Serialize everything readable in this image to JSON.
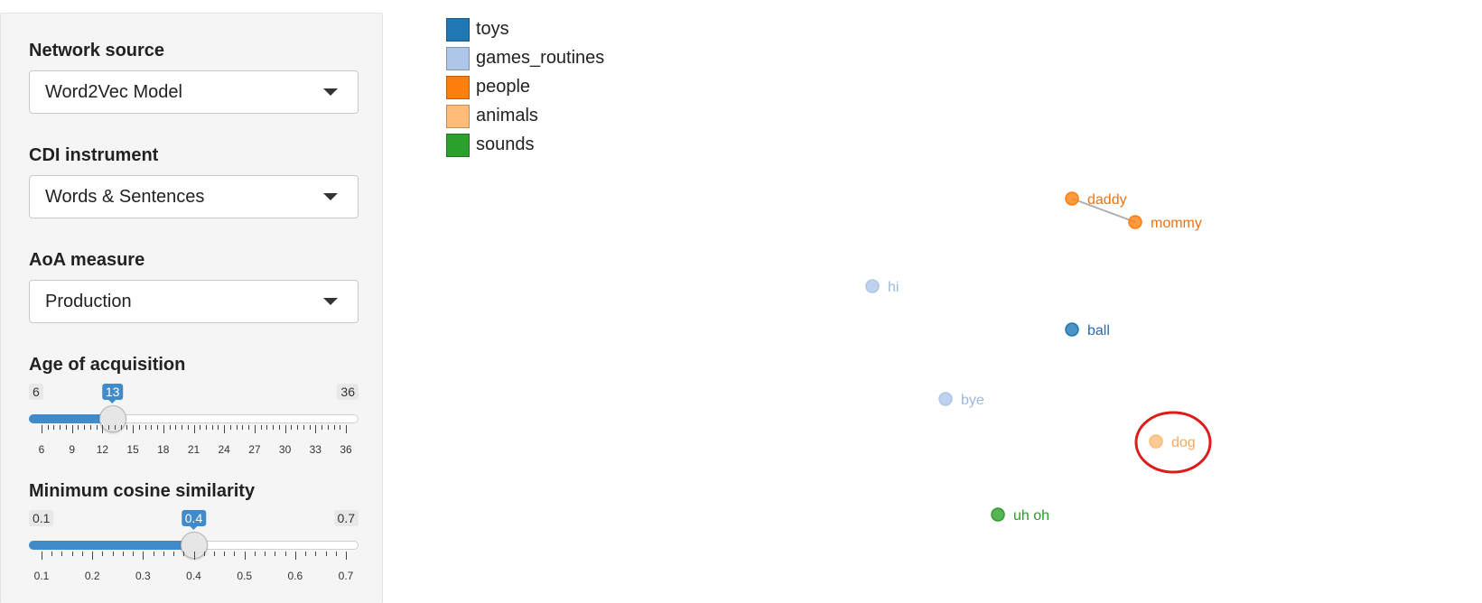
{
  "sidebar": {
    "network_source": {
      "label": "Network source",
      "value": "Word2Vec Model"
    },
    "cdi_instrument": {
      "label": "CDI instrument",
      "value": "Words & Sentences"
    },
    "aoa_measure": {
      "label": "AoA measure",
      "value": "Production"
    },
    "age_of_acquisition": {
      "label": "Age of acquisition",
      "min": 6,
      "max": 36,
      "value": 13,
      "min_label": "6",
      "max_label": "36",
      "value_label": "13",
      "tick_labels": [
        "6",
        "9",
        "12",
        "15",
        "18",
        "21",
        "24",
        "27",
        "30",
        "33",
        "36"
      ]
    },
    "min_cosine_similarity": {
      "label": "Minimum cosine similarity",
      "min": 0.1,
      "max": 0.7,
      "value": 0.4,
      "min_label": "0.1",
      "max_label": "0.7",
      "value_label": "0.4",
      "tick_labels": [
        "0.1",
        "0.2",
        "0.3",
        "0.4",
        "0.5",
        "0.6",
        "0.7"
      ]
    }
  },
  "legend": [
    {
      "label": "toys",
      "color": "#1f77b4"
    },
    {
      "label": "games_routines",
      "color": "#aec7e8"
    },
    {
      "label": "people",
      "color": "#ff7f0e"
    },
    {
      "label": "animals",
      "color": "#ffbb78"
    },
    {
      "label": "sounds",
      "color": "#2ca02c"
    }
  ],
  "network": {
    "nodes": [
      {
        "id": "daddy",
        "label": "daddy",
        "category": "people"
      },
      {
        "id": "mommy",
        "label": "mommy",
        "category": "people"
      },
      {
        "id": "hi",
        "label": "hi",
        "category": "games_routines"
      },
      {
        "id": "ball",
        "label": "ball",
        "category": "toys"
      },
      {
        "id": "bye",
        "label": "bye",
        "category": "games_routines"
      },
      {
        "id": "dog",
        "label": "dog",
        "category": "animals",
        "highlighted": true
      },
      {
        "id": "uhoh",
        "label": "uh oh",
        "category": "sounds"
      }
    ],
    "edges": [
      {
        "source": "daddy",
        "target": "mommy"
      }
    ],
    "highlight_color": "#e01b1b"
  }
}
